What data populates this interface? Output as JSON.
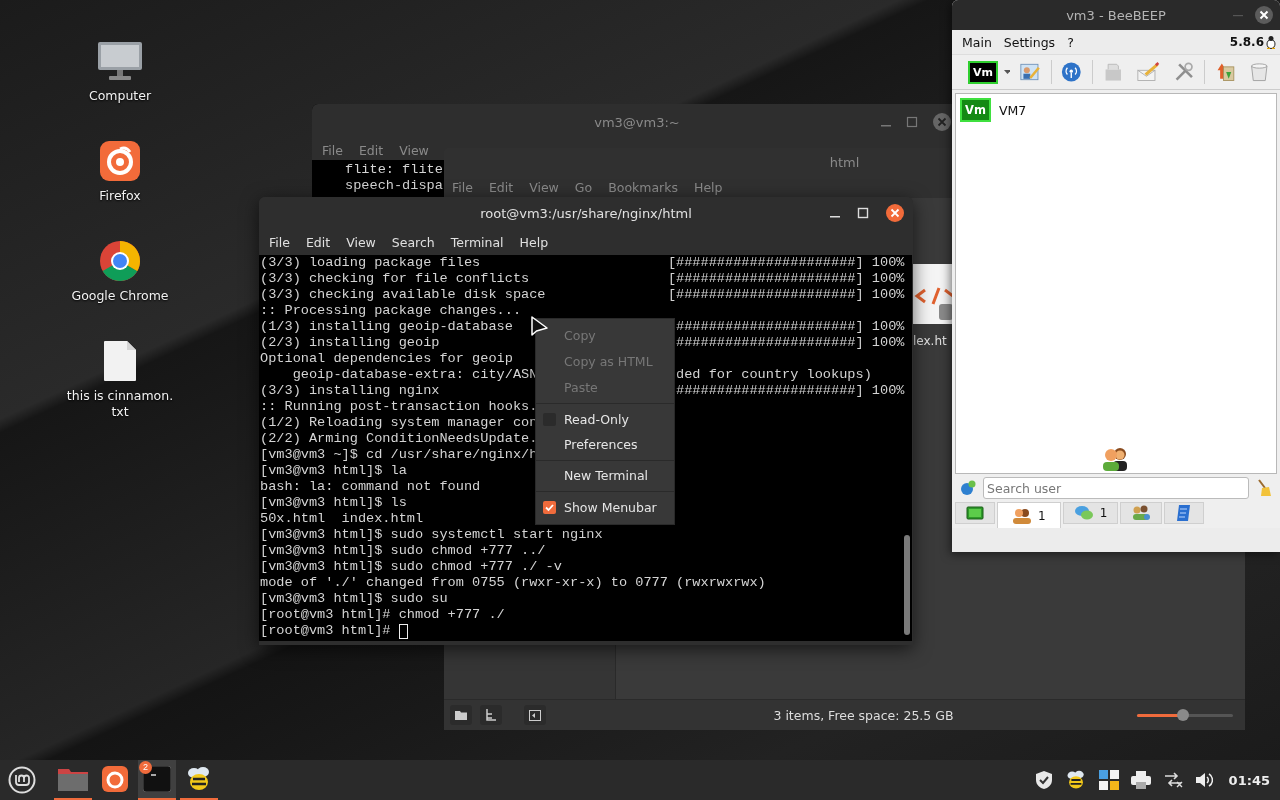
{
  "desktop_icons": [
    {
      "kind": "computer",
      "label": "Computer"
    },
    {
      "kind": "firefox",
      "label": "Firefox"
    },
    {
      "kind": "chrome",
      "label": "Google Chrome"
    },
    {
      "kind": "textfile",
      "label": "this is cinnamon. txt"
    }
  ],
  "back_terminal": {
    "title": "vm3@vm3:~",
    "menu": [
      "File",
      "Edit",
      "View"
    ],
    "lines": [
      "flite: flite",
      "speech-dispa"
    ]
  },
  "file_manager": {
    "title": "html",
    "menu": [
      "File",
      "Edit",
      "View",
      "Go",
      "Bookmarks",
      "Help"
    ],
    "file_label": "lex.ht",
    "status": "3 items, Free space: 25.5 GB",
    "zoom": {
      "level": 0.48
    }
  },
  "terminal": {
    "title": "root@vm3:/usr/share/nginx/html",
    "menu": [
      "File",
      "Edit",
      "View",
      "Search",
      "Terminal",
      "Help"
    ],
    "lines": [
      {
        "kind": "progress",
        "text": "(3/3) loading package files",
        "right": "[######################] 100%"
      },
      {
        "kind": "progress",
        "text": "(3/3) checking for file conflicts",
        "right": "[######################] 100%"
      },
      {
        "kind": "progress",
        "text": "(3/3) checking available disk space",
        "right": "[######################] 100%"
      },
      {
        "kind": "plain",
        "text": ":: Processing package changes..."
      },
      {
        "kind": "split",
        "text": "(1/3) installing geoip-database",
        "right": "######################] 100%"
      },
      {
        "kind": "split",
        "text": "(2/3) installing geoip",
        "right": "######################] 100%"
      },
      {
        "kind": "plain",
        "text": "Optional dependencies for geoip"
      },
      {
        "kind": "split",
        "text": "    geoip-database-extra: city/ASN",
        "right": "ded for country lookups)"
      },
      {
        "kind": "split",
        "text": "(3/3) installing nginx",
        "right": "######################] 100%"
      },
      {
        "kind": "plain",
        "text": ":: Running post-transaction hooks."
      },
      {
        "kind": "plain",
        "text": "(1/2) Reloading system manager con"
      },
      {
        "kind": "plain",
        "text": "(2/2) Arming ConditionNeedsUpdate."
      },
      {
        "kind": "plain",
        "text": "[vm3@vm3 ~]$ cd /usr/share/nginx/h"
      },
      {
        "kind": "plain",
        "text": "[vm3@vm3 html]$ la"
      },
      {
        "kind": "plain",
        "text": "bash: la: command not found"
      },
      {
        "kind": "plain",
        "text": "[vm3@vm3 html]$ ls"
      },
      {
        "kind": "plain",
        "text": "50x.html  index.html"
      },
      {
        "kind": "plain",
        "text": "[vm3@vm3 html]$ sudo systemctl start nginx"
      },
      {
        "kind": "plain",
        "text": "[vm3@vm3 html]$ sudo chmod +777 ../"
      },
      {
        "kind": "plain",
        "text": "[vm3@vm3 html]$ sudo chmod +777 ./ -v"
      },
      {
        "kind": "plain",
        "text": "mode of './' changed from 0755 (rwxr-xr-x) to 0777 (rwxrwxrwx)"
      },
      {
        "kind": "plain",
        "text": "[vm3@vm3 html]$ sudo su"
      },
      {
        "kind": "plain",
        "text": "[root@vm3 html]# chmod +777 ./"
      },
      {
        "kind": "prompt",
        "text": "[root@vm3 html]#"
      }
    ]
  },
  "context_menu": {
    "items": [
      {
        "kind": "action",
        "label": "Copy",
        "disabled": true
      },
      {
        "kind": "action",
        "label": "Copy as HTML",
        "disabled": true
      },
      {
        "kind": "action",
        "label": "Paste",
        "disabled": true
      },
      {
        "kind": "separator"
      },
      {
        "kind": "check",
        "label": "Read-Only",
        "checked": false
      },
      {
        "kind": "action",
        "label": "Preferences",
        "disabled": false
      },
      {
        "kind": "separator"
      },
      {
        "kind": "action",
        "label": "New Terminal",
        "disabled": false
      },
      {
        "kind": "separator"
      },
      {
        "kind": "check",
        "label": "Show Menubar",
        "checked": true
      }
    ]
  },
  "beebeep": {
    "title": "vm3 - BeeBEEP",
    "menu": [
      "Main",
      "Settings",
      "?"
    ],
    "version": "5.8.6",
    "toolbar_avatar": "Vm",
    "users": [
      {
        "avatar": "Vm",
        "name": "VM7"
      }
    ],
    "search": {
      "placeholder": "Search user"
    },
    "tabs": [
      {
        "kind": "screen",
        "selected": false
      },
      {
        "kind": "users",
        "count": "1",
        "selected": true
      },
      {
        "kind": "chats",
        "count": "1",
        "selected": false
      },
      {
        "kind": "groups",
        "selected": false
      },
      {
        "kind": "notes",
        "selected": false
      }
    ]
  },
  "taskbar": {
    "apps": [
      {
        "kind": "files",
        "running": true,
        "active": false
      },
      {
        "kind": "firefox",
        "running": false,
        "active": false
      },
      {
        "kind": "terminal",
        "running": true,
        "active": true,
        "badge": "2"
      },
      {
        "kind": "beebeep",
        "running": true,
        "active": false
      }
    ],
    "clock": "01:45"
  }
}
